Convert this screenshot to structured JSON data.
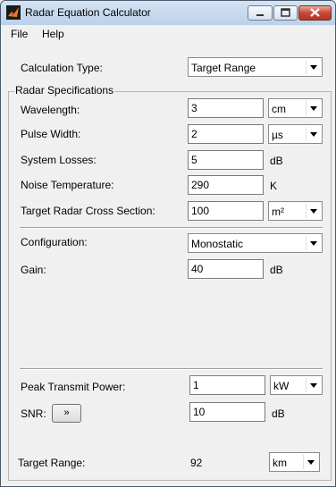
{
  "window": {
    "title": "Radar Equation Calculator"
  },
  "menu": {
    "file": "File",
    "help": "Help"
  },
  "calc_type": {
    "label": "Calculation Type:",
    "value": "Target Range"
  },
  "specs": {
    "title": "Radar Specifications",
    "wavelength": {
      "label": "Wavelength:",
      "value": "3",
      "unit": "cm"
    },
    "pulse_width": {
      "label": "Pulse Width:",
      "value": "2",
      "unit": "µs"
    },
    "system_losses": {
      "label": "System Losses:",
      "value": "5",
      "unit": "dB"
    },
    "noise_temp": {
      "label": "Noise Temperature:",
      "value": "290",
      "unit": "K"
    },
    "rcs": {
      "label": "Target Radar Cross Section:",
      "value": "100",
      "unit": "m²"
    },
    "configuration": {
      "label": "Configuration:",
      "value": "Monostatic"
    },
    "gain": {
      "label": "Gain:",
      "value": "40",
      "unit": "dB"
    },
    "peak_power": {
      "label": "Peak Transmit Power:",
      "value": "1",
      "unit": "kW"
    },
    "snr": {
      "label": "SNR:",
      "button": "»",
      "value": "10",
      "unit": "dB"
    }
  },
  "result": {
    "label": "Target Range:",
    "value": "92",
    "unit": "km"
  }
}
